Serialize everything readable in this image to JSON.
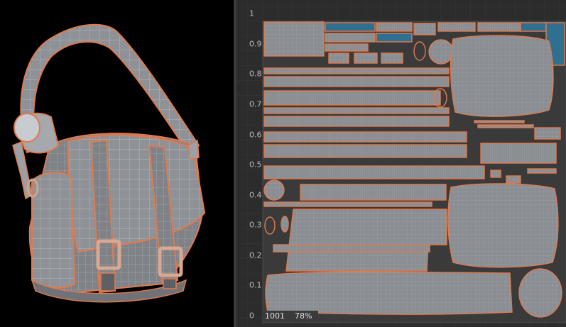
{
  "uv_editor": {
    "axis_labels": [
      "1",
      "0.9",
      "0.8",
      "0.7",
      "0.6",
      "0.5",
      "0.4",
      "0.3",
      "0.2",
      "0.1",
      "0"
    ],
    "udim_tile": "1001",
    "zoom": "78%"
  },
  "colors": {
    "background": "#000000",
    "panel_background": "#2f2f2f",
    "uv_tile": "#3a3a3a",
    "mesh_fill": "#8c8f93",
    "seam_outline": "#e07a4f",
    "wire_lines": "#b9bcc0"
  }
}
